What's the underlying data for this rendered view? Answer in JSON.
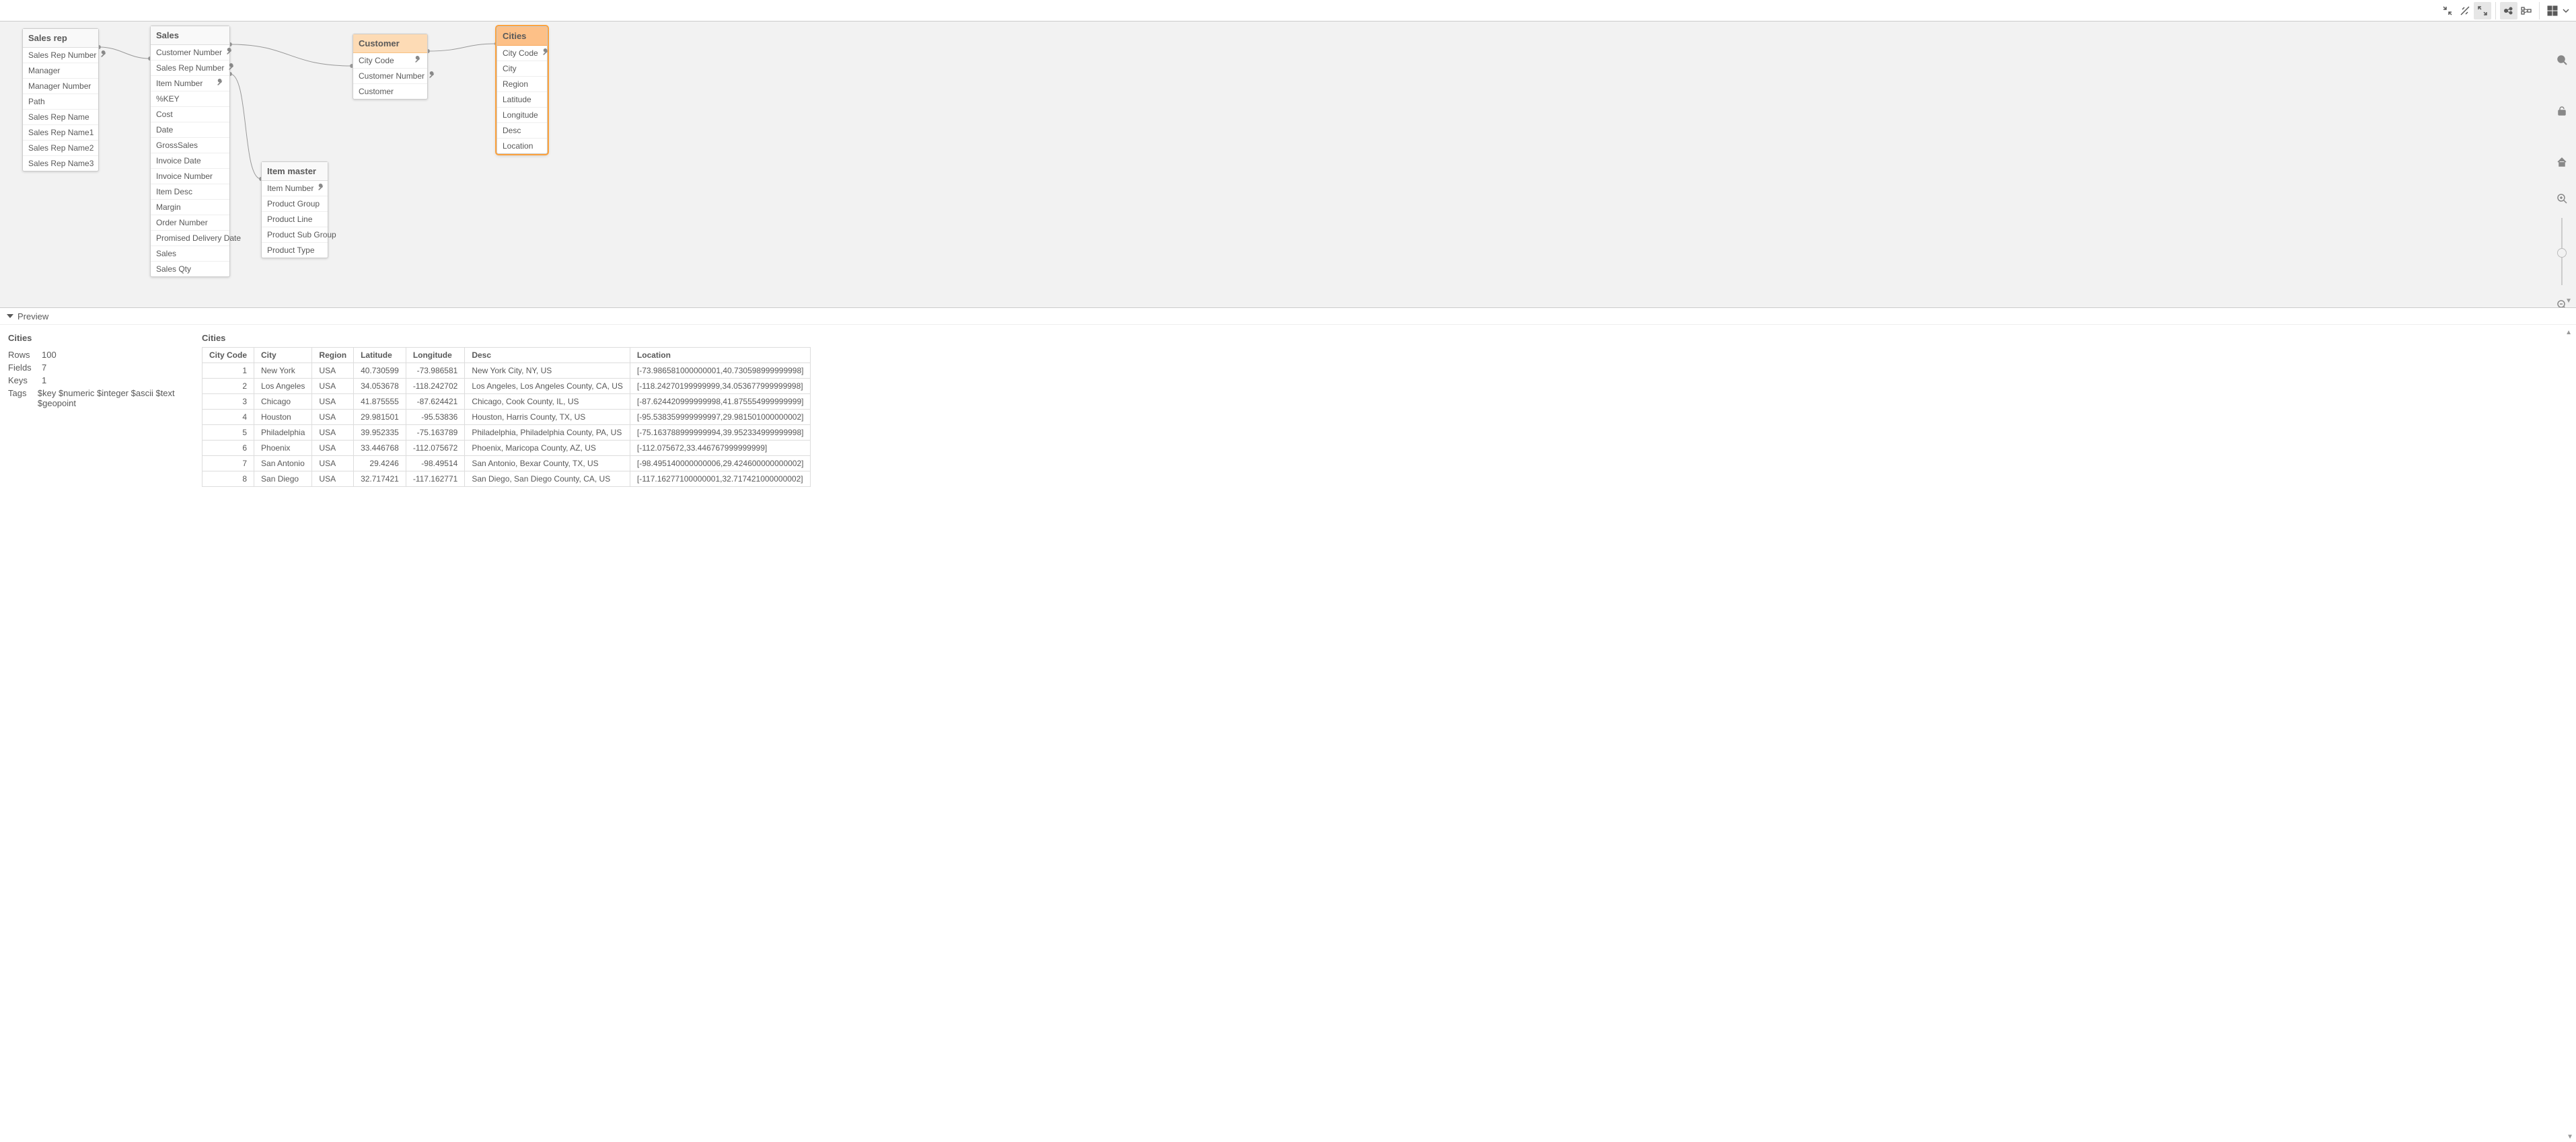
{
  "toolbar": {
    "buttons": [
      "collapse-all",
      "hide-links",
      "expand-all",
      "internal-view",
      "source-view",
      "layout"
    ]
  },
  "canvas": {
    "tables": {
      "salesrep": {
        "title": "Sales rep",
        "fields": [
          {
            "name": "Sales Rep Number",
            "key": true
          },
          {
            "name": "Manager"
          },
          {
            "name": "Manager Number"
          },
          {
            "name": "Path"
          },
          {
            "name": "Sales Rep Name"
          },
          {
            "name": "Sales Rep Name1"
          },
          {
            "name": "Sales Rep Name2"
          },
          {
            "name": "Sales Rep Name3"
          }
        ]
      },
      "sales": {
        "title": "Sales",
        "fields": [
          {
            "name": "Customer Number",
            "key": true
          },
          {
            "name": "Sales Rep Number",
            "key": true
          },
          {
            "name": "Item Number",
            "key": true
          },
          {
            "name": "%KEY"
          },
          {
            "name": "Cost"
          },
          {
            "name": "Date"
          },
          {
            "name": "GrossSales"
          },
          {
            "name": "Invoice Date"
          },
          {
            "name": "Invoice Number"
          },
          {
            "name": "Item Desc"
          },
          {
            "name": "Margin"
          },
          {
            "name": "Order Number"
          },
          {
            "name": "Promised Delivery Date"
          },
          {
            "name": "Sales"
          },
          {
            "name": "Sales Qty"
          }
        ]
      },
      "customer": {
        "title": "Customer",
        "fields": [
          {
            "name": "City Code",
            "key": true
          },
          {
            "name": "Customer Number",
            "key": true
          },
          {
            "name": "Customer"
          }
        ]
      },
      "item": {
        "title": "Item master",
        "fields": [
          {
            "name": "Item Number",
            "key": true
          },
          {
            "name": "Product Group"
          },
          {
            "name": "Product Line"
          },
          {
            "name": "Product Sub Group"
          },
          {
            "name": "Product Type"
          }
        ]
      },
      "cities": {
        "title": "Cities",
        "fields": [
          {
            "name": "City Code",
            "key": true
          },
          {
            "name": "City"
          },
          {
            "name": "Region"
          },
          {
            "name": "Latitude"
          },
          {
            "name": "Longitude"
          },
          {
            "name": "Desc"
          },
          {
            "name": "Location"
          }
        ]
      }
    }
  },
  "preview": {
    "header": "Preview",
    "meta": {
      "title": "Cities",
      "rows_label": "Rows",
      "rows": "100",
      "fields_label": "Fields",
      "fields": "7",
      "keys_label": "Keys",
      "keys": "1",
      "tags_label": "Tags",
      "tags": "$key $numeric $integer $ascii $text $geopoint"
    },
    "data": {
      "title": "Cities",
      "columns": [
        "City Code",
        "City",
        "Region",
        "Latitude",
        "Longitude",
        "Desc",
        "Location"
      ],
      "rows": [
        {
          "code": "1",
          "city": "New York",
          "region": "USA",
          "lat": "40.730599",
          "lon": "-73.986581",
          "desc": "New York City, NY, US",
          "loc": "[-73.986581000000001,40.730598999999998]"
        },
        {
          "code": "2",
          "city": "Los Angeles",
          "region": "USA",
          "lat": "34.053678",
          "lon": "-118.242702",
          "desc": "Los Angeles, Los Angeles County, CA, US",
          "loc": "[-118.24270199999999,34.053677999999998]"
        },
        {
          "code": "3",
          "city": "Chicago",
          "region": "USA",
          "lat": "41.875555",
          "lon": "-87.624421",
          "desc": "Chicago, Cook County, IL, US",
          "loc": "[-87.624420999999998,41.875554999999999]"
        },
        {
          "code": "4",
          "city": "Houston",
          "region": "USA",
          "lat": "29.981501",
          "lon": "-95.53836",
          "desc": "Houston, Harris County, TX, US",
          "loc": "[-95.538359999999997,29.981501000000002]"
        },
        {
          "code": "5",
          "city": "Philadelphia",
          "region": "USA",
          "lat": "39.952335",
          "lon": "-75.163789",
          "desc": "Philadelphia, Philadelphia County, PA, US",
          "loc": "[-75.163788999999994,39.952334999999998]"
        },
        {
          "code": "6",
          "city": "Phoenix",
          "region": "USA",
          "lat": "33.446768",
          "lon": "-112.075672",
          "desc": "Phoenix, Maricopa County, AZ, US",
          "loc": "[-112.075672,33.446767999999999]"
        },
        {
          "code": "7",
          "city": "San Antonio",
          "region": "USA",
          "lat": "29.4246",
          "lon": "-98.49514",
          "desc": "San Antonio, Bexar County, TX, US",
          "loc": "[-98.495140000000006,29.424600000000002]"
        },
        {
          "code": "8",
          "city": "San Diego",
          "region": "USA",
          "lat": "32.717421",
          "lon": "-117.162771",
          "desc": "San Diego, San Diego County, CA, US",
          "loc": "[-117.16277100000001,32.717421000000002]"
        }
      ]
    }
  }
}
